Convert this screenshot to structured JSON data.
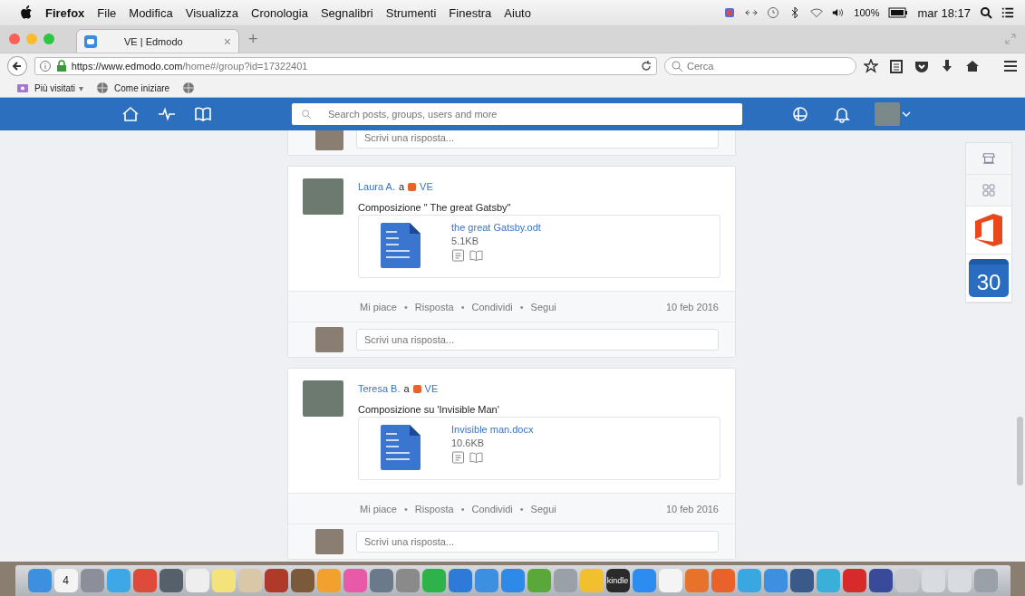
{
  "menu_bar": {
    "app": "Firefox",
    "menus": [
      "File",
      "Modifica",
      "Visualizza",
      "Cronologia",
      "Segnalibri",
      "Strumenti",
      "Finestra",
      "Aiuto"
    ],
    "battery": "100%",
    "clock": "mar 18:17"
  },
  "browser": {
    "tab": {
      "title": "VE | Edmodo",
      "new_tab": "+",
      "close": "×"
    },
    "url_host": "https://www.edmodo.com",
    "url_path": "/home#/group?id=17322401",
    "search_placeholder": "Cerca",
    "bookmarks": [
      {
        "label": "Più visitati",
        "kind": "folder",
        "caret": "▾"
      },
      {
        "label": "Come iniziare",
        "kind": "globe"
      }
    ]
  },
  "header": {
    "search_placeholder": "Search posts, groups, users and more"
  },
  "top_reply": {
    "placeholder": "Scrivi una risposta..."
  },
  "posts": [
    {
      "author": "Laura A.",
      "to": "a",
      "group": "VE",
      "separator": "•",
      "text": "Composizione \" The great Gatsby\"",
      "file": {
        "name": "the great Gatsby.odt",
        "size": "5.1KB"
      },
      "actions": [
        "Mi piace",
        "Risposta",
        "Condividi",
        "Segui"
      ],
      "date": "10 feb 2016",
      "reply_placeholder": "Scrivi una risposta..."
    },
    {
      "author": "Teresa B.",
      "to": "a",
      "group": "VE",
      "separator": "•",
      "text": "Composizione su 'Invisible Man'",
      "file": {
        "name": "Invisible man.docx",
        "size": "10.6KB"
      },
      "actions": [
        "Mi piace",
        "Risposta",
        "Condividi",
        "Segui"
      ],
      "date": "10 feb 2016",
      "reply_placeholder": "Scrivi una risposta..."
    }
  ],
  "side_widget": {
    "calendar_day": "30"
  },
  "dock": [
    {
      "color": "#3d8fe0"
    },
    {
      "color": "#f4f4f4",
      "label": "4"
    },
    {
      "color": "#8a8f99"
    },
    {
      "color": "#3da7e8"
    },
    {
      "color": "#e04a3a"
    },
    {
      "color": "#55606a"
    },
    {
      "color": "#eeeeee"
    },
    {
      "color": "#f4e27a"
    },
    {
      "color": "#d8c8a8"
    },
    {
      "color": "#b03a2a"
    },
    {
      "color": "#7a5a3a"
    },
    {
      "color": "#f2a12e"
    },
    {
      "color": "#e85aa8"
    },
    {
      "color": "#6a7a8a"
    },
    {
      "color": "#8a8a8a"
    },
    {
      "color": "#2db34a"
    },
    {
      "color": "#2e7ad8"
    },
    {
      "color": "#3d8fe0"
    },
    {
      "color": "#2e8ae8"
    },
    {
      "color": "#5aa83a"
    },
    {
      "color": "#9aa0a8"
    },
    {
      "color": "#f2c02e"
    },
    {
      "color": "#2a2a2a",
      "label": "kindle"
    },
    {
      "color": "#2d8cf0"
    },
    {
      "color": "#f4f4f4"
    },
    {
      "color": "#e8722a"
    },
    {
      "color": "#e8622a"
    },
    {
      "color": "#3aa8e0"
    },
    {
      "color": "#3d8fe0"
    },
    {
      "color": "#3a5a8a"
    },
    {
      "color": "#3ab0d8"
    },
    {
      "color": "#d82a2a"
    },
    {
      "color": "#3a4a9a"
    },
    {
      "color": "#c8ccd0"
    },
    {
      "color": "#d8dce0"
    },
    {
      "color": "#d8dce0"
    },
    {
      "color": "#9aa0a8"
    }
  ]
}
